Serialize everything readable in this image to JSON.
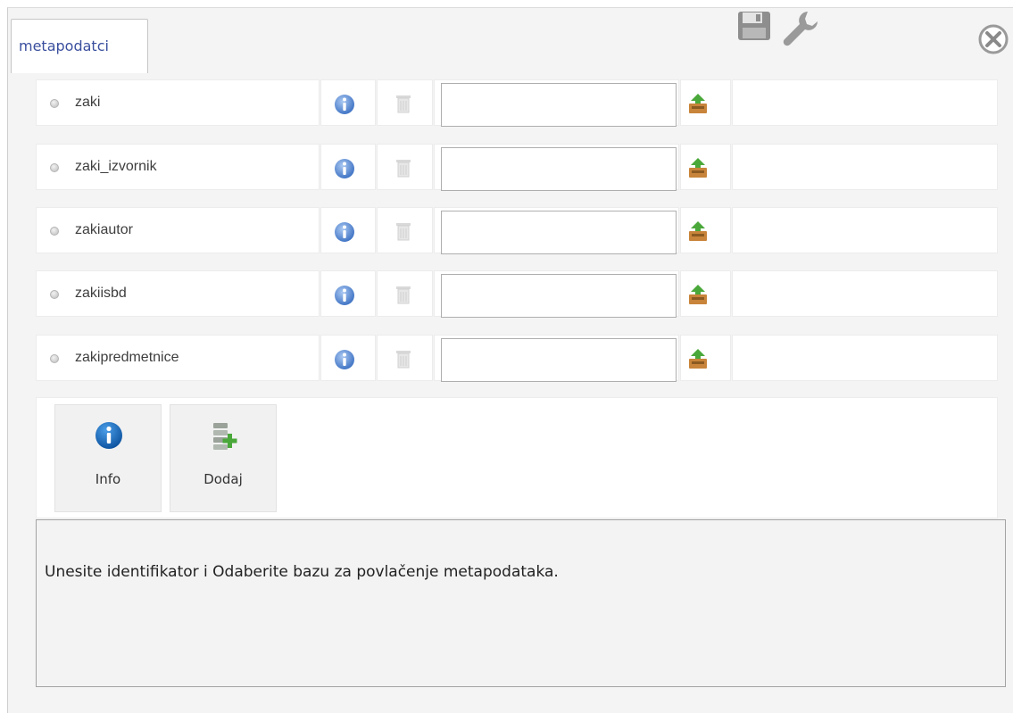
{
  "tab": {
    "label": "metapodatci"
  },
  "toolbar": {
    "save_icon": "save-icon",
    "settings_icon": "wrench-icon",
    "close_icon": "close-icon"
  },
  "rows": [
    {
      "name": "zaki",
      "value": "",
      "placeholder": ""
    },
    {
      "name": "zaki_izvornik",
      "value": "",
      "placeholder": ""
    },
    {
      "name": "zakiautor",
      "value": "",
      "placeholder": ""
    },
    {
      "name": "zakiisbd",
      "value": "",
      "placeholder": ""
    },
    {
      "name": "zakipredmetnice",
      "value": "",
      "placeholder": ""
    }
  ],
  "buttons": {
    "info_label": "Info",
    "dodaj_label": "Dodaj"
  },
  "message": "Unesite identifikator i Odaberite bazu za povlačenje metapodataka.",
  "colors": {
    "tab_text": "#3a4f9e",
    "info_blue": "#2e6fc0",
    "add_green": "#4aa83a"
  }
}
